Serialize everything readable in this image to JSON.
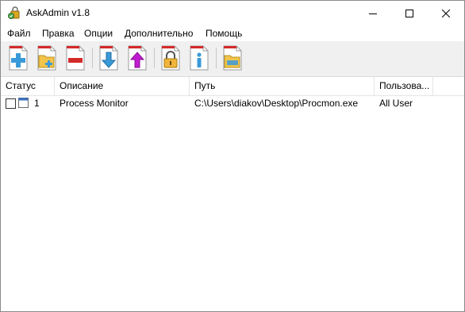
{
  "window": {
    "title": "AskAdmin v1.8"
  },
  "menu": [
    "Файл",
    "Правка",
    "Опции",
    "Дополнительно",
    "Помощь"
  ],
  "toolbar": {
    "buttons": [
      {
        "icon": "add-icon"
      },
      {
        "icon": "add-folder-icon"
      },
      {
        "icon": "remove-icon"
      },
      {
        "icon": "move-down-icon"
      },
      {
        "icon": "move-up-icon"
      },
      {
        "icon": "lock-icon"
      },
      {
        "icon": "info-icon"
      },
      {
        "icon": "open-folder-icon"
      }
    ]
  },
  "table": {
    "columns": [
      "Статус",
      "Описание",
      "Путь",
      "Пользова..."
    ],
    "rows": [
      {
        "checked": false,
        "index": "1",
        "description": "Process Monitor",
        "path": "C:\\Users\\diakov\\Desktop\\Procmon.exe",
        "user": "All User"
      }
    ]
  },
  "colors": {
    "toolbar_bg": "#f0f0f0",
    "accent_blue": "#3a9ad9",
    "accent_red": "#d42a2a",
    "accent_magenta": "#c21bd1",
    "folder_yellow": "#f3c44a"
  }
}
